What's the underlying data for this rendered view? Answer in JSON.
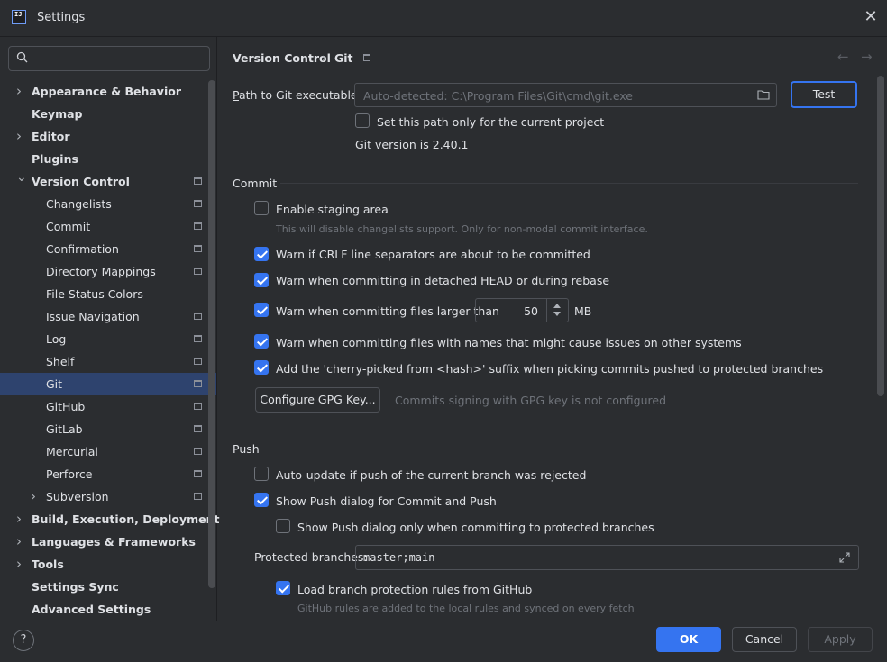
{
  "window": {
    "title": "Settings",
    "app_icon_text": "IJ"
  },
  "search": {
    "placeholder": ""
  },
  "sidebar": {
    "items": [
      {
        "label": "Appearance & Behavior",
        "level": 0,
        "expandable": true,
        "expanded": false,
        "project": false
      },
      {
        "label": "Keymap",
        "level": 0,
        "expandable": false,
        "project": false
      },
      {
        "label": "Editor",
        "level": 0,
        "expandable": true,
        "expanded": false,
        "project": false
      },
      {
        "label": "Plugins",
        "level": 0,
        "expandable": false,
        "project": false
      },
      {
        "label": "Version Control",
        "level": 0,
        "expandable": true,
        "expanded": true,
        "project": true
      },
      {
        "label": "Changelists",
        "level": 1,
        "project": true
      },
      {
        "label": "Commit",
        "level": 1,
        "project": true
      },
      {
        "label": "Confirmation",
        "level": 1,
        "project": true
      },
      {
        "label": "Directory Mappings",
        "level": 1,
        "project": true
      },
      {
        "label": "File Status Colors",
        "level": 1,
        "project": false
      },
      {
        "label": "Issue Navigation",
        "level": 1,
        "project": true
      },
      {
        "label": "Log",
        "level": 1,
        "project": true
      },
      {
        "label": "Shelf",
        "level": 1,
        "project": true
      },
      {
        "label": "Git",
        "level": 1,
        "project": true,
        "selected": true
      },
      {
        "label": "GitHub",
        "level": 1,
        "project": true
      },
      {
        "label": "GitLab",
        "level": 1,
        "project": true
      },
      {
        "label": "Mercurial",
        "level": 1,
        "project": true
      },
      {
        "label": "Perforce",
        "level": 1,
        "project": true
      },
      {
        "label": "Subversion",
        "level": 1,
        "expandable": true,
        "expanded": false,
        "project": true
      },
      {
        "label": "Build, Execution, Deployment",
        "level": 0,
        "expandable": true,
        "expanded": false,
        "project": false
      },
      {
        "label": "Languages & Frameworks",
        "level": 0,
        "expandable": true,
        "expanded": false,
        "project": false
      },
      {
        "label": "Tools",
        "level": 0,
        "expandable": true,
        "expanded": false,
        "project": false
      },
      {
        "label": "Settings Sync",
        "level": 0,
        "expandable": false,
        "project": false
      },
      {
        "label": "Advanced Settings",
        "level": 0,
        "expandable": false,
        "project": false
      }
    ]
  },
  "breadcrumb": {
    "parent": "Version Control",
    "separator": "›",
    "current": "Git"
  },
  "git": {
    "path_label": "Path to Git executable:",
    "path_placeholder": "Auto-detected: C:\\Program Files\\Git\\cmd\\git.exe",
    "test_button": "Test",
    "current_project_only": {
      "label": "Set this path only for the current project",
      "checked": false
    },
    "version_text": "Git version is 2.40.1"
  },
  "commit": {
    "section_title": "Commit",
    "staging": {
      "label": "Enable staging area",
      "checked": false,
      "hint": "This will disable changelists support. Only for non-modal commit interface."
    },
    "crlf": {
      "label": "Warn if CRLF line separators are about to be committed",
      "checked": true
    },
    "detached": {
      "label": "Warn when committing in detached HEAD or during rebase",
      "checked": true
    },
    "large_files": {
      "label": "Warn when committing files larger than",
      "checked": true,
      "value": "50",
      "unit": "MB"
    },
    "bad_names": {
      "label": "Warn when committing files with names that might cause issues on other systems",
      "checked": true
    },
    "cherry_pick": {
      "label": "Add the 'cherry-picked from <hash>' suffix when picking commits pushed to protected branches",
      "checked": true
    },
    "gpg_button": "Configure GPG Key...",
    "gpg_status": "Commits signing with GPG key is not configured"
  },
  "push": {
    "section_title": "Push",
    "auto_update": {
      "label": "Auto-update if push of the current branch was rejected",
      "checked": false
    },
    "show_dialog": {
      "label": "Show Push dialog for Commit and Push",
      "checked": true
    },
    "show_dialog_protected": {
      "label": "Show Push dialog only when committing to protected branches",
      "checked": false
    },
    "protected_label": "Protected branches:",
    "protected_value": "master;main",
    "load_rules": {
      "label": "Load branch protection rules from GitHub",
      "checked": true,
      "hint": "GitHub rules are added to the local rules and synced on every fetch"
    }
  },
  "footer": {
    "help": "?",
    "ok": "OK",
    "cancel": "Cancel",
    "apply": "Apply"
  },
  "colors": {
    "accent": "#3574f0",
    "selection": "#2e436e",
    "background": "#2b2d30"
  }
}
